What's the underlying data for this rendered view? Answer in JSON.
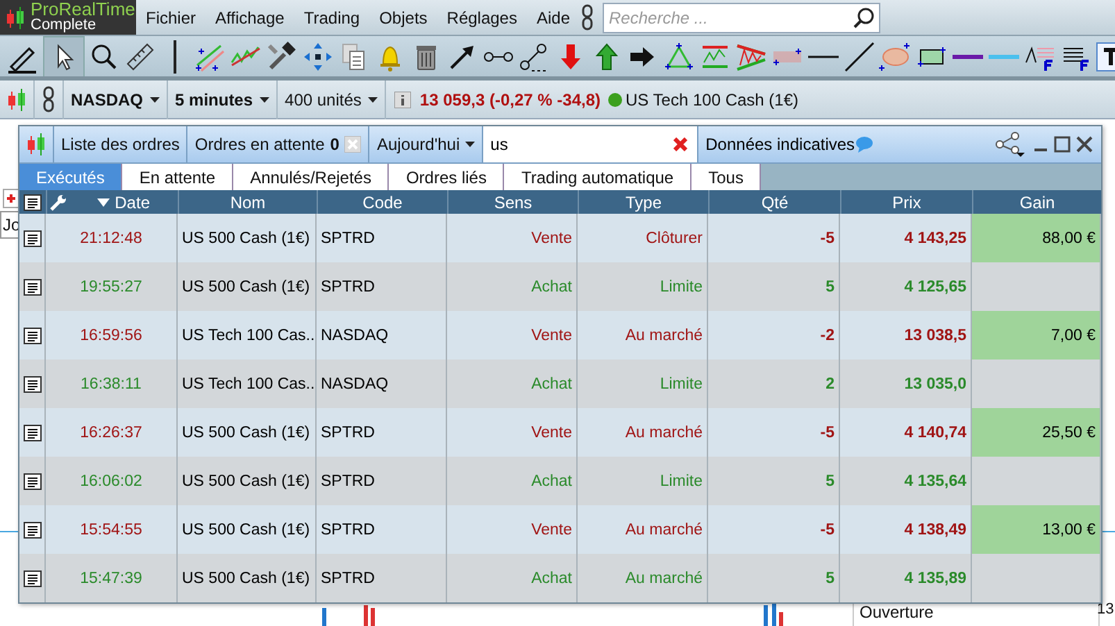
{
  "app": {
    "name": "ProRealTime",
    "edition": "Complete"
  },
  "menu": [
    "Fichier",
    "Affichage",
    "Trading",
    "Objets",
    "Réglages",
    "Aide"
  ],
  "search": {
    "placeholder": "Recherche ..."
  },
  "symbol_bar": {
    "instrument": "NASDAQ",
    "period": "5 minutes",
    "units": "400 unités",
    "quote": "13 059,3 (-0,27 % -34,8)",
    "market_open": true,
    "instrument_name": "US Tech 100 Cash (1€)"
  },
  "background": {
    "left_label": "Jo",
    "bottom_label": "Ouverture",
    "right_label": "13"
  },
  "orders_window": {
    "title": "Liste des ordres",
    "pending_label": "Ordres en attente",
    "pending_count": "0",
    "period": "Aujourd'hui",
    "filter": "us",
    "data_note": "Données indicatives",
    "tabs": [
      {
        "label": "Exécutés",
        "selected": true
      },
      {
        "label": "En attente",
        "selected": false
      },
      {
        "label": "Annulés/Rejetés",
        "selected": false
      },
      {
        "label": "Ordres liés",
        "selected": false
      },
      {
        "label": "Trading automatique",
        "selected": false
      },
      {
        "label": "Tous",
        "selected": false
      }
    ],
    "columns": [
      "Date",
      "Nom",
      "Code",
      "Sens",
      "Type",
      "Qté",
      "Prix",
      "Gain"
    ],
    "rows": [
      {
        "kind": "sell",
        "date": "21:12:48",
        "name": "US 500 Cash (1€)",
        "code": "SPTRD",
        "side": "Vente",
        "type": "Clôturer",
        "qty": "-5",
        "price": "4 143,25",
        "gain": "88,00 €"
      },
      {
        "kind": "buy",
        "date": "19:55:27",
        "name": "US 500 Cash (1€)",
        "code": "SPTRD",
        "side": "Achat",
        "type": "Limite",
        "qty": "5",
        "price": "4 125,65"
      },
      {
        "kind": "sell",
        "date": "16:59:56",
        "name": "US Tech 100 Cas...",
        "code": "NASDAQ",
        "side": "Vente",
        "type": "Au marché",
        "qty": "-2",
        "price": "13 038,5",
        "gain": "7,00 €"
      },
      {
        "kind": "buy",
        "date": "16:38:11",
        "name": "US Tech 100 Cas...",
        "code": "NASDAQ",
        "side": "Achat",
        "type": "Limite",
        "qty": "2",
        "price": "13 035,0"
      },
      {
        "kind": "sell",
        "date": "16:26:37",
        "name": "US 500 Cash (1€)",
        "code": "SPTRD",
        "side": "Vente",
        "type": "Au marché",
        "qty": "-5",
        "price": "4 140,74",
        "gain": "25,50 €"
      },
      {
        "kind": "buy",
        "date": "16:06:02",
        "name": "US 500 Cash (1€)",
        "code": "SPTRD",
        "side": "Achat",
        "type": "Limite",
        "qty": "5",
        "price": "4 135,64"
      },
      {
        "kind": "sell",
        "date": "15:54:55",
        "name": "US 500 Cash (1€)",
        "code": "SPTRD",
        "side": "Vente",
        "type": "Au marché",
        "qty": "-5",
        "price": "4 138,49",
        "gain": "13,00 €"
      },
      {
        "kind": "buy",
        "date": "15:47:39",
        "name": "US 500 Cash (1€)",
        "code": "SPTRD",
        "side": "Achat",
        "type": "Au marché",
        "qty": "5",
        "price": "4 135,89"
      }
    ]
  }
}
